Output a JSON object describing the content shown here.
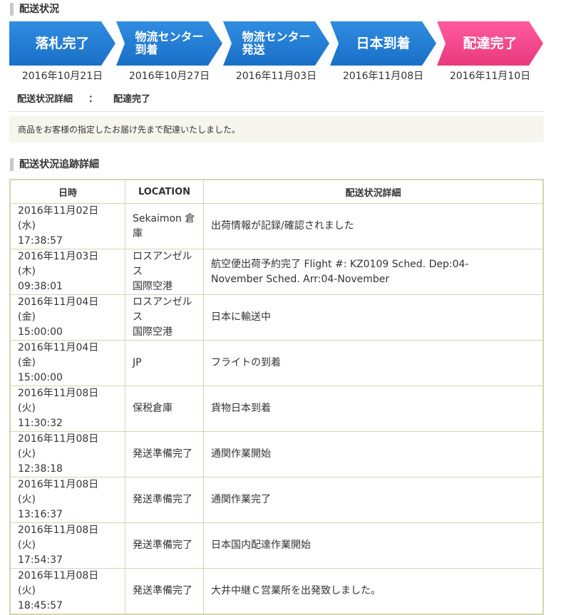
{
  "status_heading": "配送状況",
  "steps": [
    {
      "label": "落札完了",
      "color": "#1a6fc7",
      "date": "2016年10月21日"
    },
    {
      "label": "物流センター\n到着",
      "color": "#1a6fc7",
      "date": "2016年10月27日"
    },
    {
      "label": "物流センター\n発送",
      "color": "#1a6fc7",
      "date": "2016年11月03日"
    },
    {
      "label": "日本到着",
      "color": "#1a6fc7",
      "date": "2016年11月08日"
    },
    {
      "label": "配達完了",
      "color": "#e93a7d",
      "date": "2016年11月10日"
    }
  ],
  "detail": {
    "label": "配送状況詳細",
    "sep": "：",
    "value": "配達完了"
  },
  "message": "商品をお客様の指定したお届け先まで配達いたしました。",
  "tracking_heading": "配送状況追跡詳細",
  "table": {
    "headers": [
      "日時",
      "LOCATION",
      "配送状況詳細"
    ],
    "rows": [
      {
        "datetime": "2016年11月02日 (水)\n17:38:57",
        "location": "Sekaimon 倉庫",
        "detail": "出荷情報が記録/確認されました"
      },
      {
        "datetime": "2016年11月03日 (木)\n09:38:01",
        "location": "ロスアンゼルス\n国際空港",
        "detail": "航空便出荷予約完了 Flight #: KZ0109 Sched. Dep:04-\nNovember Sched. Arr:04-November"
      },
      {
        "datetime": "2016年11月04日 (金)\n15:00:00",
        "location": "ロスアンゼルス\n国際空港",
        "detail": "日本に輸送中"
      },
      {
        "datetime": "2016年11月04日 (金)\n15:00:00",
        "location": "JP",
        "detail": "フライトの到着"
      },
      {
        "datetime": "2016年11月08日 (火)\n11:30:32",
        "location": "保税倉庫",
        "detail": "貨物日本到着"
      },
      {
        "datetime": "2016年11月08日 (火)\n12:38:18",
        "location": "発送準備完了",
        "detail": "通関作業開始"
      },
      {
        "datetime": "2016年11月08日 (火)\n13:16:37",
        "location": "発送準備完了",
        "detail": "通関作業完了"
      },
      {
        "datetime": "2016年11月08日 (火)\n17:54:37",
        "location": "発送準備完了",
        "detail": "日本国内配達作業開始"
      },
      {
        "datetime": "2016年11月08日 (火)\n18:45:57",
        "location": "発送準備完了",
        "detail": "大井中継Ｃ営業所を出発致しました。"
      }
    ]
  }
}
